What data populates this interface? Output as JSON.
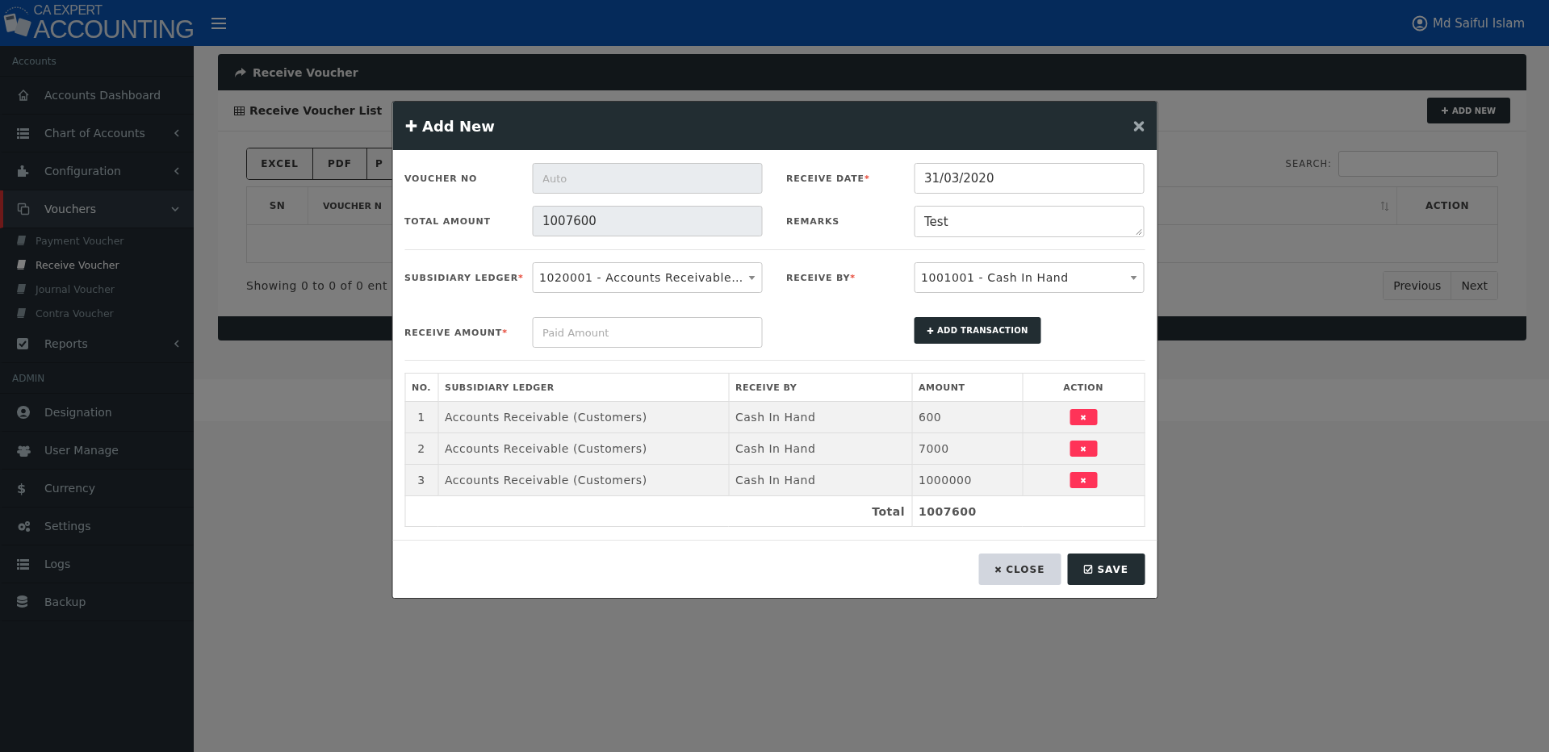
{
  "header": {
    "logo_top": "CA EXPERT",
    "logo_bottom": "ACCOUNTING",
    "user": "Md Saiful Islam"
  },
  "sidebar": {
    "items": [
      {
        "kind": "section",
        "label": "Accounts"
      },
      {
        "kind": "item",
        "label": "Accounts Dashboard"
      },
      {
        "kind": "item",
        "label": "Chart of Accounts",
        "expanded": false
      },
      {
        "kind": "item",
        "label": "Configuration",
        "expanded": false
      },
      {
        "kind": "item",
        "label": "Vouchers",
        "expanded": true,
        "children": [
          {
            "label": "Payment Voucher",
            "selected": false
          },
          {
            "label": "Receive Voucher",
            "selected": true
          },
          {
            "label": "Journal Voucher",
            "selected": false
          },
          {
            "label": "Contra Voucher",
            "selected": false
          }
        ]
      },
      {
        "kind": "item",
        "label": "Reports",
        "expanded": false
      },
      {
        "kind": "section",
        "label": "ADMIN"
      },
      {
        "kind": "item",
        "label": "Designation"
      },
      {
        "kind": "item",
        "label": "User Manage"
      },
      {
        "kind": "item",
        "label": "Currency",
        "icon_text": "$"
      },
      {
        "kind": "item",
        "label": "Settings"
      },
      {
        "kind": "item",
        "label": "Logs"
      },
      {
        "kind": "item",
        "label": "Backup"
      }
    ]
  },
  "page": {
    "title": "Receive Voucher",
    "list_title": "Receive Voucher List",
    "add_button": "ADD NEW",
    "export_buttons": [
      "EXCEL",
      "PDF",
      "P"
    ],
    "search_label": "SEARCH:",
    "columns": [
      "SN",
      "VOUCHER N",
      "ACTION"
    ],
    "info": "Showing 0 to 0 of 0 ent",
    "pagination": [
      "Previous",
      "Next"
    ]
  },
  "modal": {
    "title": "Add New",
    "field_groups": [
      [
        {
          "label": "VOUCHER NO",
          "required": false,
          "kind": "input",
          "disabled": true,
          "placeholder": "Auto"
        },
        {
          "label": "RECEIVE DATE",
          "required": true,
          "kind": "input",
          "disabled": false,
          "value": "31/03/2020"
        },
        {
          "label": "TOTAL AMOUNT",
          "required": false,
          "kind": "input",
          "disabled": true,
          "value": "1007600"
        },
        {
          "label": "REMARKS",
          "required": false,
          "kind": "textarea",
          "disabled": false,
          "value": "Test"
        }
      ],
      [
        {
          "label": "SUBSIDIARY LEDGER",
          "required": true,
          "kind": "select",
          "disabled": false,
          "value": "1020001 - Accounts Receivable…"
        },
        {
          "label": "RECEIVE BY",
          "required": true,
          "kind": "select",
          "disabled": false,
          "value": "1001001 - Cash In Hand"
        },
        {
          "label": "RECEIVE AMOUNT",
          "required": true,
          "kind": "input",
          "disabled": false,
          "placeholder": "Paid Amount"
        }
      ]
    ],
    "required_mark": "*",
    "add_transaction": "ADD TRANSACTION",
    "table": {
      "columns": [
        "NO.",
        "SUBSIDIARY LEDGER",
        "RECEIVE BY",
        "AMOUNT",
        "ACTION"
      ],
      "rows": [
        {
          "no": "1",
          "ledger": "Accounts Receivable (Customers)",
          "receive_by": "Cash In Hand",
          "amount": "600"
        },
        {
          "no": "2",
          "ledger": "Accounts Receivable (Customers)",
          "receive_by": "Cash In Hand",
          "amount": "7000"
        },
        {
          "no": "3",
          "ledger": "Accounts Receivable (Customers)",
          "receive_by": "Cash In Hand",
          "amount": "1000000"
        }
      ],
      "total_label": "Total",
      "total": "1007600"
    },
    "buttons": {
      "close": "CLOSE",
      "save": "SAVE"
    }
  }
}
